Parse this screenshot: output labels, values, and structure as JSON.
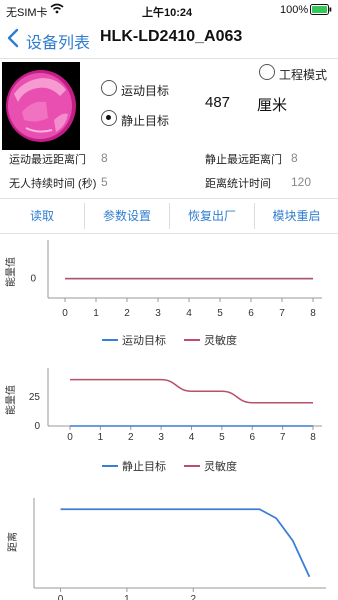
{
  "status": {
    "carrier": "无SIM卡",
    "time": "上午10:24",
    "battery": "100%"
  },
  "nav": {
    "back_label": "设备列表",
    "title": "HLK-LD2410_A063"
  },
  "mode": {
    "engineering_label": "工程模式",
    "moving_label": "运动目标",
    "static_label": "静止目标",
    "selected": "静止目标"
  },
  "distance": {
    "value": "487",
    "unit": "厘米"
  },
  "params": {
    "moving_max_gate_label": "运动最远距离门",
    "moving_max_gate_value": "8",
    "static_max_gate_label": "静止最远距离门",
    "static_max_gate_value": "8",
    "no_one_duration_label": "无人持续时间 (秒)",
    "no_one_duration_value": "5",
    "distance_stat_time_label": "距离统计时间",
    "distance_stat_time_value": "120"
  },
  "buttons": {
    "read": "读取",
    "param_settings": "参数设置",
    "factory_reset": "恢复出厂",
    "module_restart": "模块重启"
  },
  "colors": {
    "accent": "#2f7dd1",
    "moving_series": "#3b7dd8",
    "sensitivity_series": "#b8506a"
  },
  "chart_data": [
    {
      "type": "line",
      "ylabel": "能量值",
      "x": [
        0,
        1,
        2,
        3,
        4,
        5,
        6,
        7,
        8
      ],
      "yticks": [
        0
      ],
      "ylim": [
        -10,
        20
      ],
      "legend_position": "bottom",
      "series": [
        {
          "name": "运动目标",
          "values": [
            0,
            0,
            0,
            0,
            0,
            0,
            0,
            0,
            0
          ]
        },
        {
          "name": "灵敏度",
          "values": [
            0,
            0,
            0,
            0,
            0,
            0,
            0,
            0,
            0
          ]
        }
      ]
    },
    {
      "type": "line",
      "ylabel": "能量值",
      "x": [
        0,
        1,
        2,
        3,
        4,
        5,
        6,
        7,
        8
      ],
      "yticks": [
        0,
        25
      ],
      "ylim": [
        0,
        50
      ],
      "legend_position": "bottom",
      "series": [
        {
          "name": "静止目标",
          "values": [
            0,
            0,
            0,
            0,
            0,
            0,
            0,
            0,
            0
          ]
        },
        {
          "name": "灵敏度",
          "values": [
            40,
            40,
            40,
            40,
            30,
            30,
            20,
            20,
            20
          ]
        }
      ]
    },
    {
      "type": "line",
      "ylabel": "距离",
      "x": [
        0,
        0.5,
        1,
        1.5,
        2,
        2.5,
        3,
        3.25,
        3.5,
        3.75
      ],
      "values": [
        500,
        500,
        500,
        500,
        500,
        500,
        500,
        460,
        360,
        200
      ],
      "xticks_visible": [
        "0",
        "1",
        "2"
      ],
      "ylim": [
        150,
        550
      ]
    }
  ]
}
